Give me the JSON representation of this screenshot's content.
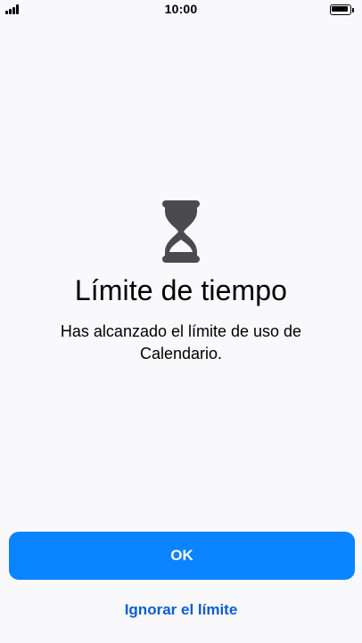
{
  "status_bar": {
    "time": "10:00",
    "signal_bars": 4,
    "battery_level": 1.0
  },
  "screen": {
    "icon": "hourglass-icon",
    "title": "Límite de tiempo",
    "message": "Has alcanzado el límite de uso de Calendario."
  },
  "actions": {
    "ok_label": "OK",
    "ignore_label": "Ignorar el límite"
  },
  "colors": {
    "background": "#f9f8fa",
    "accent": "#0a84ff",
    "link": "#0a5fcf",
    "icon": "#4b4b4f"
  }
}
